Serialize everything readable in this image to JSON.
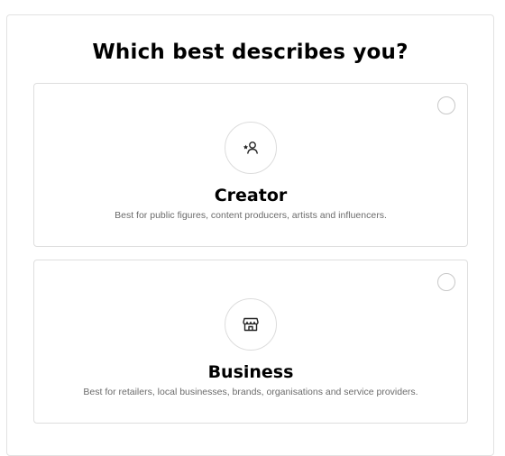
{
  "page": {
    "title": "Which best describes you?"
  },
  "options": [
    {
      "title": "Creator",
      "description": "Best for public figures, content producers, artists and influencers.",
      "icon": "creator-person-star-icon",
      "selected": false
    },
    {
      "title": "Business",
      "description": "Best for retailers, local businesses, brands, organisations and service providers.",
      "icon": "storefront-icon",
      "selected": false
    }
  ],
  "colors": {
    "text": "#000000",
    "muted_text": "#6b6b6b",
    "border": "#dedede"
  }
}
